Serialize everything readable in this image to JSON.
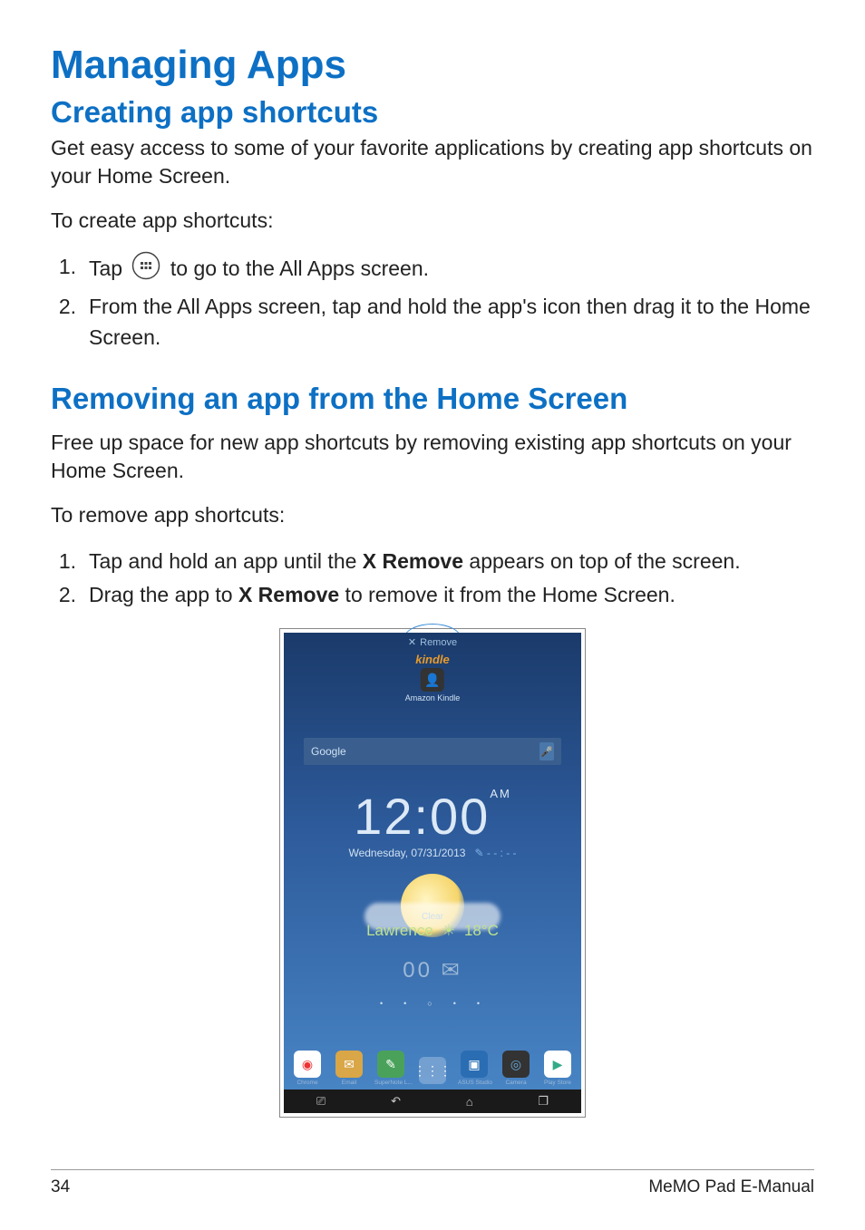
{
  "headings": {
    "h1": "Managing Apps",
    "h2a": "Creating app shortcuts",
    "h2b": "Removing an app from the Home Screen"
  },
  "paragraphs": {
    "intro_a": "Get easy access to some of your favorite applications by creating app shortcuts on your Home Screen.",
    "lead_a": "To create app shortcuts:",
    "intro_b": "Free up space for new app shortcuts by removing existing app shortcuts on your Home Screen.",
    "lead_b": "To remove app shortcuts:"
  },
  "list_a": {
    "i1_num": "1.",
    "i1_pre": "Tap ",
    "i1_post": " to go to the All Apps screen.",
    "i2_num": "2.",
    "i2_text": "From the All Apps screen, tap and hold the app's icon then drag it to the Home Screen."
  },
  "list_b": {
    "i1_num": "1.",
    "i1_pre": "Tap and hold an app until the ",
    "i1_bold": "X Remove",
    "i1_post": " appears on top of the screen.",
    "i2_num": "2.",
    "i2_pre": "Drag the app to ",
    "i2_bold": "X Remove",
    "i2_post": " to remove it from the Home Screen."
  },
  "screenshot": {
    "remove_label": "Remove",
    "kindle_brand": "kindle",
    "kindle_label": "Amazon Kindle",
    "search_placeholder": "Google",
    "clock_time": "12:00",
    "clock_ampm": "AM",
    "date_text": "Wednesday, 07/31/2013",
    "weather_city": "Lawrence",
    "weather_cond": "Clear",
    "weather_temp": "18°C",
    "mail_count": "00",
    "dock": {
      "chrome": "Chrome",
      "email": "Email",
      "supernote": "SuperNote L...",
      "allapps": "",
      "studio": "ASUS Studio",
      "camera": "Camera",
      "play": "Play Store"
    }
  },
  "footer": {
    "page_num": "34",
    "doc_title": "MeMO Pad E-Manual"
  }
}
